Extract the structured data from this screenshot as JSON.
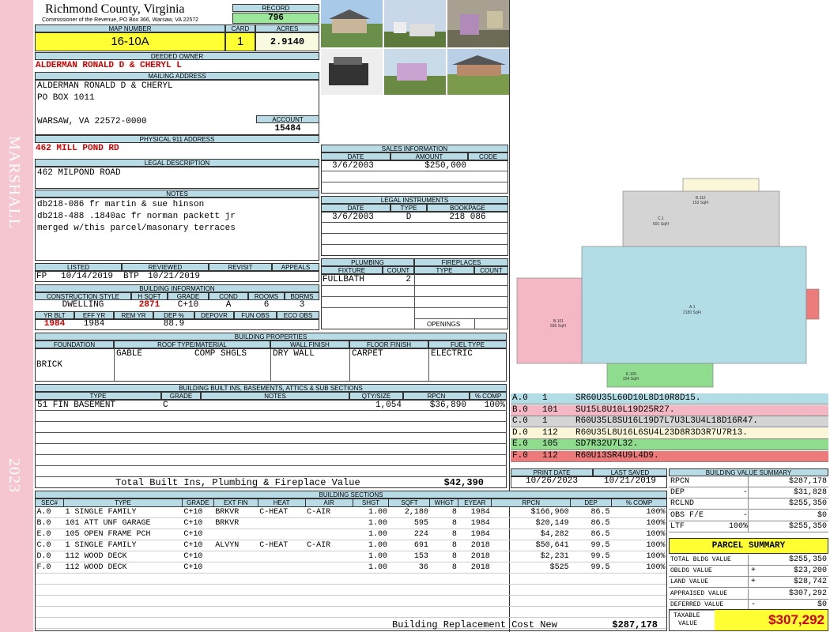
{
  "side": {
    "name": "MARSHALL",
    "year": "2023"
  },
  "county": {
    "name": "Richmond County, Virginia",
    "sub": "Commissioner of the Revenue, PO Box 366, Warsaw, VA 22572"
  },
  "record": {
    "label": "RECORD",
    "value": "796"
  },
  "map": {
    "label": "MAP NUMBER",
    "value": "16-10A"
  },
  "card": {
    "label": "CARD",
    "value": "1"
  },
  "acres": {
    "label": "ACRES",
    "value": "2.9140"
  },
  "owner": {
    "label": "DEEDED OWNER",
    "value": "ALDERMAN RONALD D & CHERYL L"
  },
  "mailing": {
    "label": "MAILING ADDRESS",
    "line1": "ALDERMAN RONALD D & CHERYL",
    "line2": "PO BOX 1011",
    "line3": "WARSAW, VA 22572-0000"
  },
  "account": {
    "label": "ACCOUNT",
    "value": "15484"
  },
  "phys": {
    "label": "PHYSICAL 911 ADDRESS",
    "value": "462 MILL POND RD"
  },
  "legal": {
    "label": "LEGAL DESCRIPTION",
    "value": "462 MILPOND ROAD"
  },
  "notes": {
    "label": "NOTES",
    "lines": [
      "db218-086 fr martin & sue hinson",
      "db218-488 .1840ac fr norman packett jr",
      "merged w/this parcel/masonary terraces"
    ]
  },
  "listed": {
    "label": "LISTED",
    "by": "FP",
    "date": "10/14/2019"
  },
  "reviewed": {
    "label": "REVIEWED",
    "by": "BTP",
    "date": "10/21/2019"
  },
  "revisit": {
    "label": "REVISIT"
  },
  "appeals": {
    "label": "APPEALS"
  },
  "bldginfo": {
    "label": "BUILDING INFORMATION",
    "h": [
      "CONSTRUCTION STYLE",
      "H SQFT",
      "GRADE",
      "COND",
      "ROOMS",
      "BDRMS"
    ],
    "v": [
      "DWELLING",
      "2871",
      "C+10",
      "A",
      "6",
      "3"
    ],
    "h2": [
      "YR BLT",
      "EFF YR",
      "REM YR",
      "DEP %",
      "DEPOVR",
      "FUN OBS",
      "ECO OBS"
    ],
    "v2": [
      "1984",
      "1984",
      "",
      "88.9",
      "",
      "",
      ""
    ]
  },
  "props": {
    "label": "BUILDING PROPERTIES",
    "h": [
      "FOUNDATION",
      "ROOF TYPE/MATERIAL",
      "WALL FINISH",
      "FLOOR FINISH",
      "FUEL TYPE"
    ],
    "foundation": "BRICK",
    "roof1": "GABLE",
    "roof2": "COMP SHGLS",
    "wall": "DRY WALL",
    "floor": "CARPET",
    "fuel": "ELECTRIC"
  },
  "builtins": {
    "label": "BUILDING BUILT INS, BASEMENTS, ATTICS & SUB SECTIONS",
    "h": [
      "TYPE",
      "GRADE",
      "NOTES",
      "QTY/SIZE",
      "RPCN",
      "% COMP"
    ],
    "row": {
      "type": "51 FIN BASEMENT",
      "grade": "C",
      "notes": "",
      "qty": "1,054",
      "rpcn": "$36,890",
      "comp": "100%"
    },
    "total_label": "Total Built Ins, Plumbing & Fireplace Value",
    "total": "$42,390"
  },
  "sales": {
    "label": "SALES INFORMATION",
    "h": [
      "DATE",
      "AMOUNT",
      "CODE"
    ],
    "date": "3/6/2003",
    "amount": "$250,000",
    "code": ""
  },
  "instr": {
    "label": "LEGAL INSTRUMENTS",
    "h": [
      "DATE",
      "TYPE",
      "BOOKPAGE"
    ],
    "date": "3/6/2003",
    "type": "D",
    "book": "218 086"
  },
  "plumb": {
    "label": "PLUMBING",
    "h": [
      "FIXTURE",
      "COUNT"
    ],
    "fixture": "FULLBATH",
    "count": "2"
  },
  "fire": {
    "label": "FIREPLACES",
    "h": [
      "TYPE",
      "COUNT"
    ],
    "openings": "OPENINGS"
  },
  "sketch": {
    "labels": [
      "A.1",
      "2180 SqFt",
      "B.101",
      "595 SqFt",
      "C.1",
      "691 SqFt",
      "B.112",
      "153 SqFt",
      "E.105",
      "224 SqFt"
    ]
  },
  "legend": [
    {
      "code": "A.0",
      "num": "1",
      "desc": "SR60U35L60D10L8D10R8D15.",
      "color": "#b3dde6"
    },
    {
      "code": "B.0",
      "num": "101",
      "desc": "SU15L8U10L19D25R27.",
      "color": "#f4b8c4"
    },
    {
      "code": "C.0",
      "num": "1",
      "desc": "R60U35L8SU16L19D7L7U3L3U4L18D16R47.",
      "color": "#d4d4d4"
    },
    {
      "code": "D.0",
      "num": "112",
      "desc": "R60U35L8U16L6SU4L23D8R3D3R7U7R13.",
      "color": "#fbf6d8"
    },
    {
      "code": "E.0",
      "num": "105",
      "desc": "SD7R32U7L32.",
      "color": "#8fdc8f"
    },
    {
      "code": "F.0",
      "num": "112",
      "desc": "R60U13SR4U9L4D9.",
      "color": "#ee7b7b"
    }
  ],
  "print": {
    "label": "PRINT DATE",
    "value": "10/26/2023"
  },
  "saved": {
    "label": "LAST SAVED",
    "value": "10/21/2019"
  },
  "bsec": {
    "label": "BUILDING SECTIONS",
    "h": [
      "SEC#",
      "TYPE",
      "GRADE",
      "EXT FIN",
      "HEAT",
      "AIR",
      "SHGT",
      "SQFT",
      "WHGT",
      "EYEAR",
      "RPCN",
      "DEP",
      "% COMP"
    ],
    "rows": [
      [
        "A.0",
        "1 SINGLE FAMILY",
        "C+10",
        "BRKVR",
        "C-HEAT",
        "C-AIR",
        "1.00",
        "2,180",
        "8",
        "1984",
        "$166,960",
        "86.5",
        "100%"
      ],
      [
        "B.0",
        "101 ATT UNF GARAGE",
        "C+10",
        "BRKVR",
        "",
        "",
        "1.00",
        "595",
        "8",
        "1984",
        "$20,149",
        "86.5",
        "100%"
      ],
      [
        "E.0",
        "105 OPEN FRAME PCH",
        "C+10",
        "",
        "",
        "",
        "1.00",
        "224",
        "8",
        "1984",
        "$4,282",
        "86.5",
        "100%"
      ],
      [
        "C.0",
        "1 SINGLE FAMILY",
        "C+10",
        "ALVYN",
        "C-HEAT",
        "C-AIR",
        "1.00",
        "691",
        "8",
        "2018",
        "$50,641",
        "99.5",
        "100%"
      ],
      [
        "D.0",
        "112 WOOD DECK",
        "C+10",
        "",
        "",
        "",
        "1.00",
        "153",
        "8",
        "2018",
        "$2,231",
        "99.5",
        "100%"
      ],
      [
        "F.0",
        "112 WOOD DECK",
        "C+10",
        "",
        "",
        "",
        "1.00",
        "36",
        "8",
        "2018",
        "$525",
        "99.5",
        "100%"
      ]
    ],
    "total_label": "Building Replacement Cost New",
    "total": "$287,178"
  },
  "bvs": {
    "label": "BUILDING VALUE SUMMARY",
    "rows": [
      {
        "k": "RPCN",
        "s": "",
        "v": "$287,178"
      },
      {
        "k": "DEP",
        "s": "-",
        "v": "$31,828"
      },
      {
        "k": "RCLND",
        "s": "",
        "v": "$255,350"
      },
      {
        "k": "OBS F/E",
        "s": "-",
        "v": "$0"
      },
      {
        "k": "LTF",
        "s": "100%",
        "v": "$255,350"
      }
    ]
  },
  "parcel": {
    "label": "PARCEL SUMMARY",
    "rows": [
      {
        "k": "TOTAL BLDG VALUE",
        "s": "",
        "v": "$255,350"
      },
      {
        "k": "OBLDG VALUE",
        "s": "+",
        "v": "$23,200"
      },
      {
        "k": "LAND VALUE",
        "s": "+",
        "v": "$28,742"
      },
      {
        "k": "APPRAISED VALUE",
        "s": "",
        "v": "$307,292"
      },
      {
        "k": "DEFERRED VALUE",
        "s": "-",
        "v": "$0"
      }
    ],
    "taxable_label1": "TAXABLE",
    "taxable_label2": "VALUE",
    "taxable": "$307,292"
  }
}
